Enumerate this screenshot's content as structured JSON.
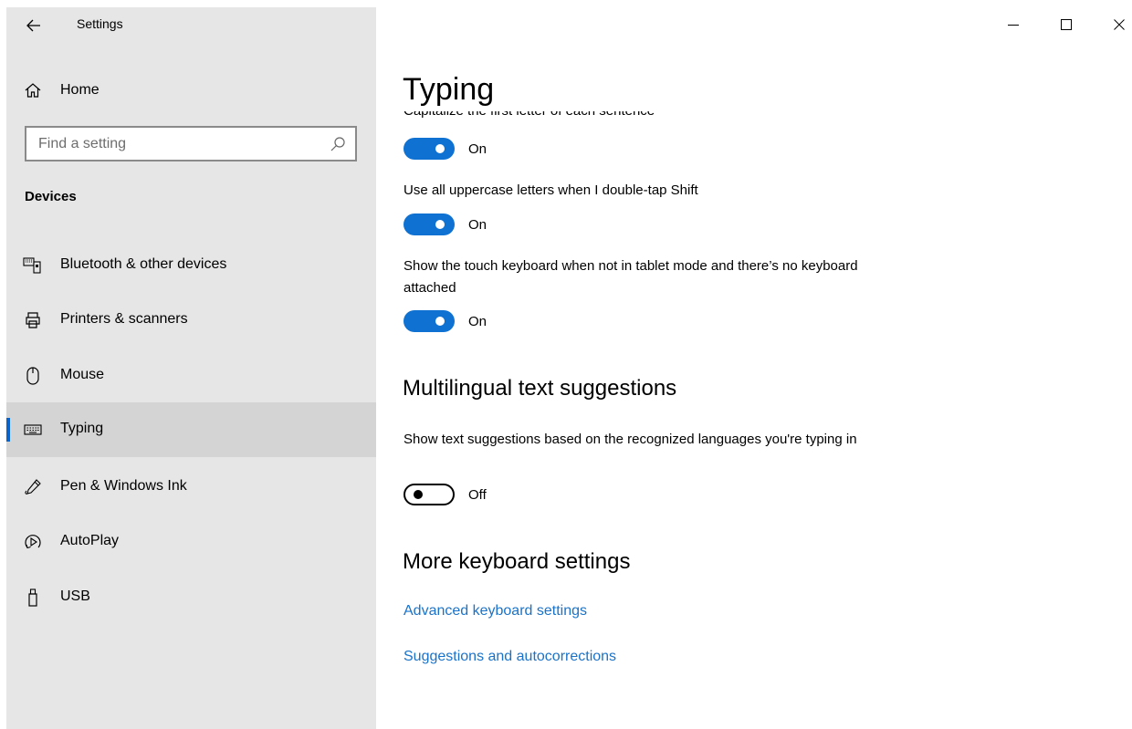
{
  "window": {
    "app_title": "Settings"
  },
  "sidebar": {
    "home_label": "Home",
    "search_placeholder": "Find a setting",
    "section_title": "Devices",
    "items": [
      {
        "label": "Bluetooth & other devices",
        "icon": "bluetooth-devices-icon"
      },
      {
        "label": "Printers & scanners",
        "icon": "printer-icon"
      },
      {
        "label": "Mouse",
        "icon": "mouse-icon"
      },
      {
        "label": "Typing",
        "icon": "keyboard-icon",
        "active": true
      },
      {
        "label": "Pen & Windows Ink",
        "icon": "pen-icon"
      },
      {
        "label": "AutoPlay",
        "icon": "autoplay-icon"
      },
      {
        "label": "USB",
        "icon": "usb-icon"
      }
    ]
  },
  "main": {
    "title": "Typing",
    "cut_label": "Capitalize the first letter of each sentence",
    "settings": [
      {
        "label": "",
        "state": "On",
        "on": true
      },
      {
        "label": "Use all uppercase letters when I double-tap Shift",
        "state": "On",
        "on": true
      },
      {
        "label": "Show the touch keyboard when not in tablet mode and there’s no keyboard attached",
        "state": "On",
        "on": true
      }
    ],
    "multilingual": {
      "heading": "Multilingual text suggestions",
      "label": "Show text suggestions based on the recognized languages you're typing in",
      "state": "Off",
      "on": false
    },
    "more": {
      "heading": "More keyboard settings",
      "links": [
        "Advanced keyboard settings",
        "Suggestions and autocorrections"
      ]
    }
  },
  "colors": {
    "accent": "#0f72d3",
    "link": "#1a73c9",
    "sidebar_bg": "#e6e6e6",
    "active_item_bg": "#d4d4d4"
  }
}
